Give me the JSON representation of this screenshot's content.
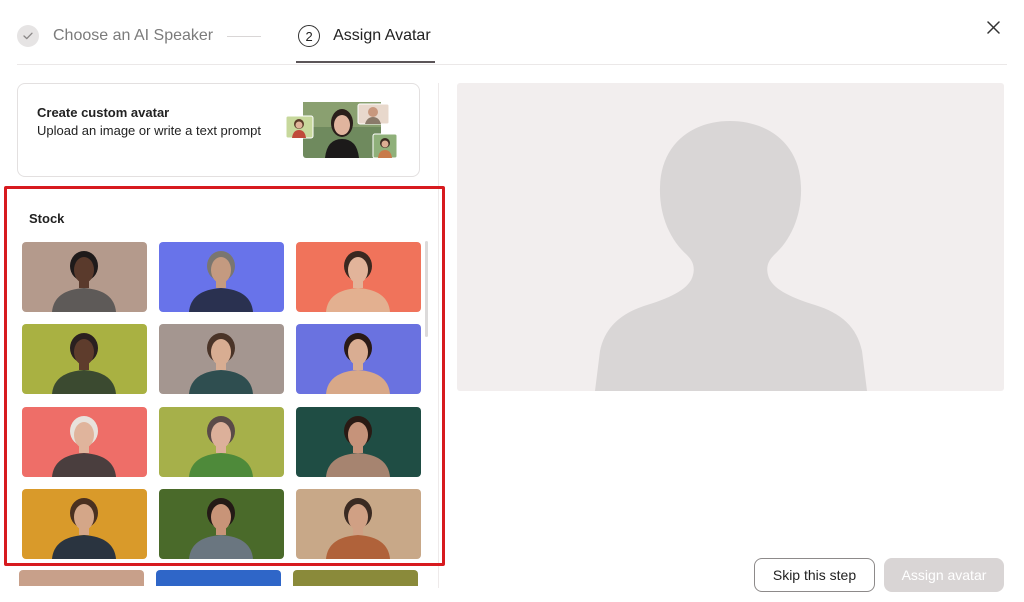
{
  "stepper": {
    "step1_label": "Choose an AI Speaker",
    "step2_number": "2",
    "step2_label": "Assign Avatar"
  },
  "custom_avatar": {
    "title": "Create custom avatar",
    "subtitle": "Upload an image or write a text prompt"
  },
  "stock": {
    "title": "Stock",
    "thumbnails": [
      {
        "bg": "#b49a8c",
        "skin": "#5a3a2c",
        "hair": "#1e1a1a",
        "shirt": "#5e5a58"
      },
      {
        "bg": "#6873ea",
        "skin": "#c49a80",
        "hair": "#7a7670",
        "shirt": "#2a3150"
      },
      {
        "bg": "#f0735b",
        "skin": "#e2b49a",
        "hair": "#3a2820",
        "shirt": "#e3b090"
      },
      {
        "bg": "#a9b142",
        "skin": "#5e3c2c",
        "hair": "#2a2020",
        "shirt": "#3b4a30"
      },
      {
        "bg": "#a49690",
        "skin": "#d8ad92",
        "hair": "#4a3428",
        "shirt": "#2f4e50"
      },
      {
        "bg": "#6a72e0",
        "skin": "#d9ad92",
        "hair": "#2a1a16",
        "shirt": "#d8a888"
      },
      {
        "bg": "#ee6e68",
        "skin": "#e0b49c",
        "hair": "#e8e2dc",
        "shirt": "#4a3e3e"
      },
      {
        "bg": "#a6b04a",
        "skin": "#dcb09a",
        "hair": "#5a4a48",
        "shirt": "#4e8a3a"
      },
      {
        "bg": "#1f4d44",
        "skin": "#c6937a",
        "hair": "#2a1a14",
        "shirt": "#a68470"
      },
      {
        "bg": "#d99a2a",
        "skin": "#d4a688",
        "hair": "#4a3020",
        "shirt": "#2a3440"
      },
      {
        "bg": "#4a6a2a",
        "skin": "#c89478",
        "hair": "#241a16",
        "shirt": "#6a7680"
      },
      {
        "bg": "#c8a888",
        "skin": "#d0a084",
        "hair": "#3a2a22",
        "shirt": "#b0623a"
      }
    ],
    "partial_row": [
      "#c8a08a",
      "#2f66c8",
      "#8a8a3a"
    ]
  },
  "buttons": {
    "skip": "Skip this step",
    "assign": "Assign avatar"
  },
  "colors": {
    "highlight_border": "#d71a1f",
    "preview_bg": "#f2eeee",
    "silhouette": "#d9d6d6",
    "assign_disabled_bg": "#d9d5d5"
  },
  "icons": {
    "step1": "check-icon",
    "close": "close-icon",
    "preview": "person-silhouette-icon"
  }
}
